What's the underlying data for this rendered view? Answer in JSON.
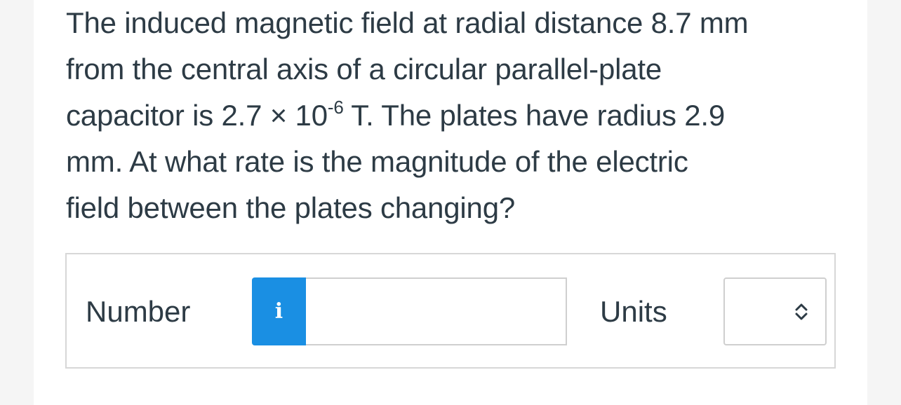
{
  "question": {
    "line1": "The induced magnetic field at radial distance 8.7 mm",
    "line2": "from the central axis of a circular parallel-plate",
    "line3_before_exp": "capacitor is 2.7 × 10",
    "exponent": "-6",
    "line3_after_exp": " T. The plates have radius 2.9",
    "line4": "mm. At what rate is the magnitude of the electric",
    "line5": "field between the plates changing?"
  },
  "answer": {
    "number_label": "Number",
    "info_icon_glyph": "i",
    "number_value": "",
    "units_label": "Units",
    "units_value": "",
    "units_icon": "chevron-up-down-icon"
  },
  "colors": {
    "info_button": "#1a8fe3",
    "text": "#2d3b45",
    "border": "#d7d7d7"
  }
}
